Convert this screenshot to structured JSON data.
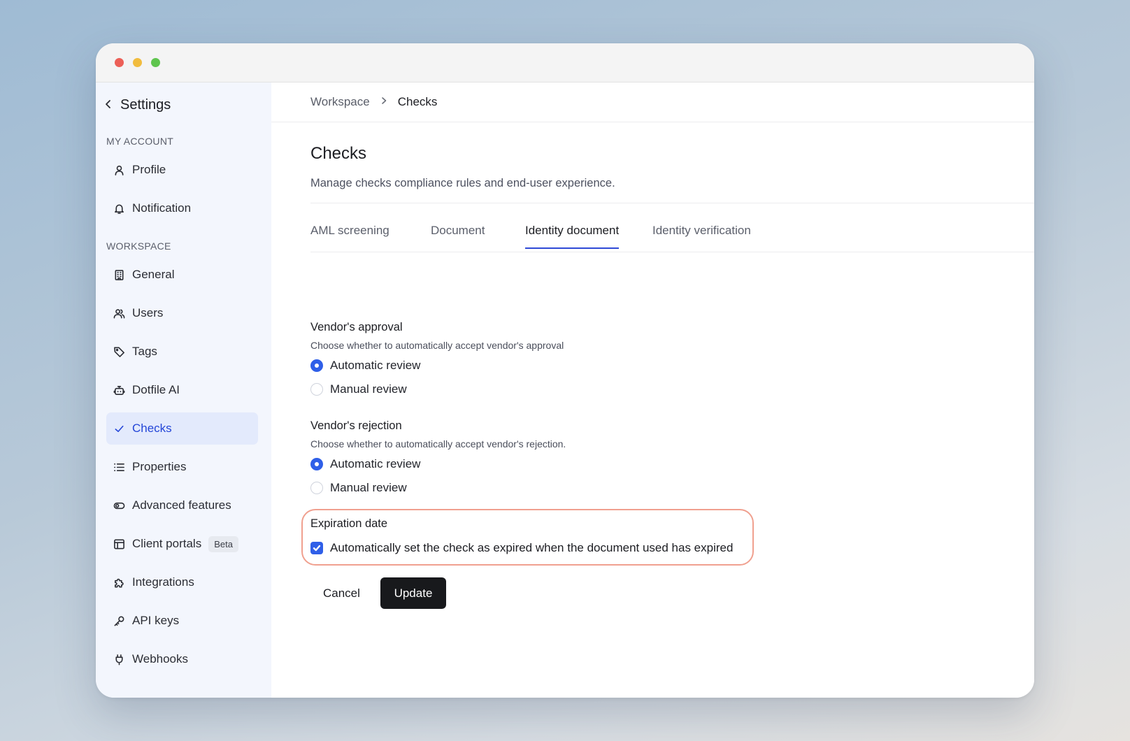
{
  "window": {
    "controls": [
      "close",
      "minimize",
      "maximize"
    ]
  },
  "sidebar": {
    "back_label": "Settings",
    "sections": {
      "my_account": "MY ACCOUNT",
      "workspace": "WORKSPACE"
    },
    "items": [
      {
        "label": "Profile",
        "icon": "user-icon"
      },
      {
        "label": "Notification",
        "icon": "bell-icon"
      },
      {
        "label": "General",
        "icon": "building-icon"
      },
      {
        "label": "Users",
        "icon": "users-icon"
      },
      {
        "label": "Tags",
        "icon": "tag-icon"
      },
      {
        "label": "Dotfile AI",
        "icon": "robot-icon"
      },
      {
        "label": "Checks",
        "icon": "check-icon",
        "active": true
      },
      {
        "label": "Properties",
        "icon": "list-icon"
      },
      {
        "label": "Advanced features",
        "icon": "toggle-icon"
      },
      {
        "label": "Client portals",
        "icon": "layout-icon",
        "badge": "Beta"
      },
      {
        "label": "Integrations",
        "icon": "puzzle-icon"
      },
      {
        "label": "API keys",
        "icon": "key-icon"
      },
      {
        "label": "Webhooks",
        "icon": "plug-icon"
      }
    ]
  },
  "breadcrumb": {
    "parent": "Workspace",
    "current": "Checks"
  },
  "page": {
    "title": "Checks",
    "description": "Manage checks compliance rules and end-user experience."
  },
  "tabs": [
    {
      "label": "AML screening"
    },
    {
      "label": "Document"
    },
    {
      "label": "Identity document",
      "active": true
    },
    {
      "label": "Identity verification"
    }
  ],
  "form": {
    "vendor_approval": {
      "title": "Vendor's approval",
      "help": "Choose whether to automatically accept vendor's approval",
      "options": [
        "Automatic review",
        "Manual review"
      ],
      "selected": "Automatic review"
    },
    "vendor_rejection": {
      "title": "Vendor's rejection",
      "help": "Choose whether to automatically accept vendor's rejection.",
      "options": [
        "Automatic review",
        "Manual review"
      ],
      "selected": "Automatic review"
    },
    "expiration": {
      "title": "Expiration date",
      "checkbox_label": "Automatically set the check as expired when the document used has expired",
      "checked": true
    }
  },
  "actions": {
    "cancel": "Cancel",
    "update": "Update"
  },
  "colors": {
    "accent": "#2f5fe8",
    "active_nav_bg": "#e3eafc",
    "highlight_border": "#f0a08f",
    "primary_button": "#18191c"
  }
}
